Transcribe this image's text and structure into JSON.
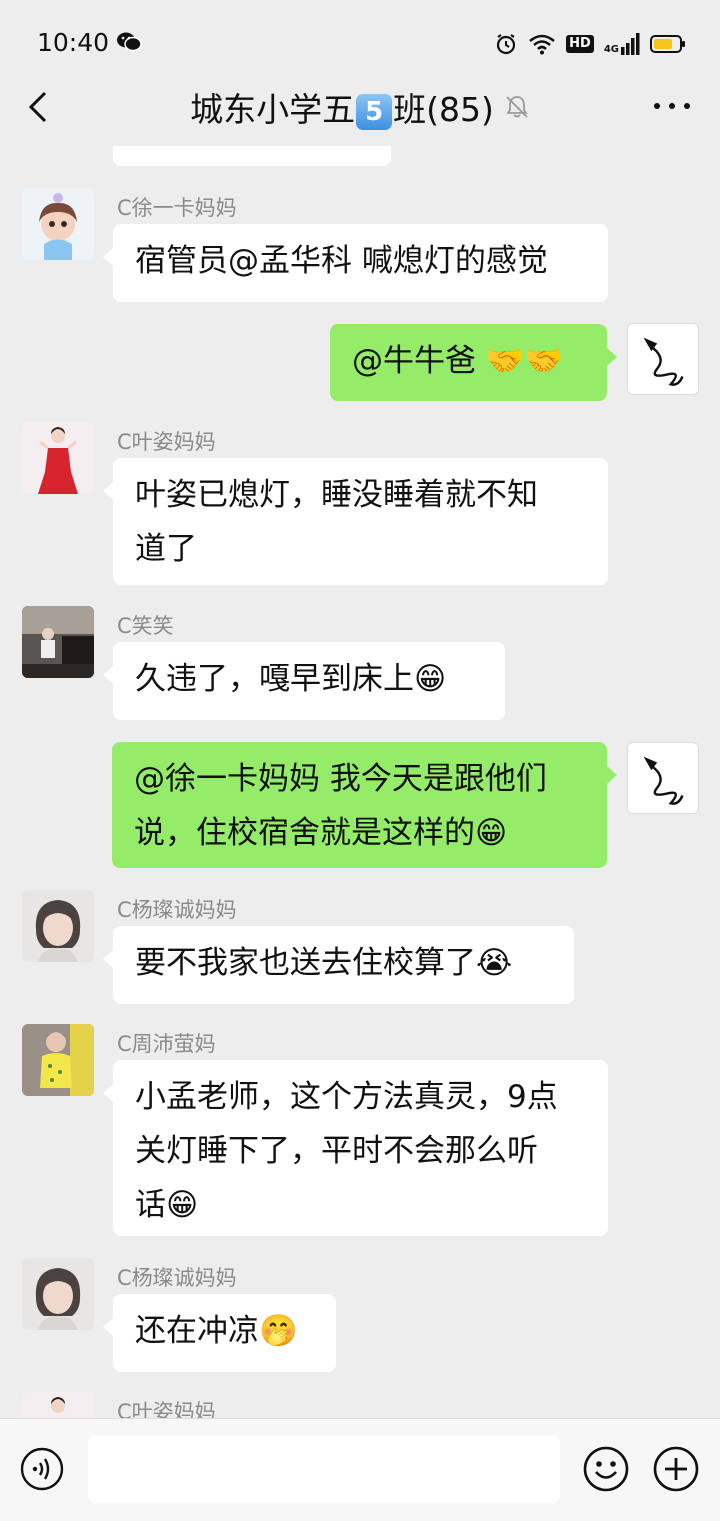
{
  "status_bar": {
    "time": "10:40",
    "network": "4G",
    "hd": "HD"
  },
  "header": {
    "title_prefix": "城东小学五",
    "title_badge": "5",
    "title_suffix": "班(85)",
    "back_icon": "chevron-left-icon",
    "mute_icon": "bell-off-icon",
    "more_icon": "more-dots-icon"
  },
  "messages": [
    {
      "sender": "C徐一卡妈妈",
      "text": "宿管员@孟华科  喊熄灯的感觉",
      "side": "left"
    },
    {
      "sender": "",
      "text": "@牛牛爸 🤝🤝",
      "side": "right"
    },
    {
      "sender": "C叶姿妈妈",
      "text_line1": "叶姿已熄灯，睡没睡着就不知",
      "text_line2": "道了",
      "side": "left"
    },
    {
      "sender": "C笑笑",
      "text": "久违了，嘎早到床上😁",
      "side": "left"
    },
    {
      "sender": "",
      "text_line1": "@徐一卡妈妈  我今天是跟他们",
      "text_line2": "说，住校宿舍就是这样的😁",
      "side": "right"
    },
    {
      "sender": "C杨璨诚妈妈",
      "text": "要不我家也送去住校算了😭",
      "side": "left"
    },
    {
      "sender": "C周沛萤妈",
      "text_line1": "小孟老师，这个方法真灵，9点",
      "text_line2": "关灯睡下了，平时不会那么听",
      "text_line3": "话😁",
      "side": "left"
    },
    {
      "sender": "C杨璨诚妈妈",
      "text": "还在冲凉🤭",
      "side": "left"
    },
    {
      "sender": "C叶姿妈妈",
      "side": "left"
    }
  ],
  "input_bar": {
    "voice_icon": "voice-icon",
    "emoji_icon": "emoji-icon",
    "plus_icon": "plus-icon",
    "input_value": ""
  },
  "colors": {
    "background": "#ededed",
    "my_bubble": "#95ec69",
    "their_bubble": "#ffffff",
    "sender_name": "#8a8a8a"
  }
}
